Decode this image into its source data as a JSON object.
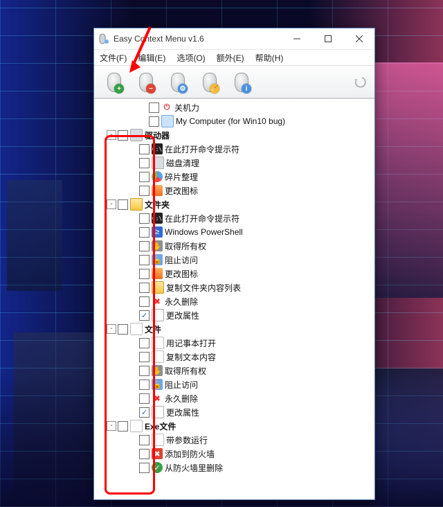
{
  "window": {
    "title": "Easy Context Menu v1.6"
  },
  "menu": {
    "file": "文件(F)",
    "edit": "编辑(E)",
    "options": "选项(O)",
    "extra": "额外(E)",
    "help": "帮助(H)"
  },
  "toolbar": {
    "btn_add": "apply-add",
    "btn_remove": "apply-remove",
    "btn_config": "settings",
    "btn_clean": "clean",
    "btn_info": "about",
    "btn_undo": "undo"
  },
  "tree": [
    {
      "indent": 60,
      "expander": null,
      "checked": false,
      "iconClass": "ic-power",
      "iconGlyph": "⏻",
      "label": "关机力",
      "bold": false
    },
    {
      "indent": 60,
      "expander": null,
      "checked": false,
      "iconClass": "ic-mon",
      "iconGlyph": "",
      "label": "My Computer (for Win10 bug)",
      "bold": false
    },
    {
      "indent": 14,
      "expander": "-",
      "checked": false,
      "iconClass": "ic-drv",
      "iconGlyph": "",
      "label": "驱动器",
      "bold": true
    },
    {
      "indent": 46,
      "expander": null,
      "checked": false,
      "iconClass": "ic-dark",
      "iconGlyph": "C:\\",
      "label": "在此打开命令提示符",
      "bold": false
    },
    {
      "indent": 46,
      "expander": null,
      "checked": false,
      "iconClass": "ic-drv",
      "iconGlyph": "",
      "label": "磁盘清理",
      "bold": false
    },
    {
      "indent": 46,
      "expander": null,
      "checked": false,
      "iconClass": "ic-pie",
      "iconGlyph": "",
      "label": "碎片整理",
      "bold": false
    },
    {
      "indent": 46,
      "expander": null,
      "checked": false,
      "iconClass": "ic-cfg",
      "iconGlyph": "",
      "label": "更改图标",
      "bold": false
    },
    {
      "indent": 14,
      "expander": "-",
      "checked": false,
      "iconClass": "ic-fold",
      "iconGlyph": "",
      "label": "文件夹",
      "bold": true
    },
    {
      "indent": 46,
      "expander": null,
      "checked": false,
      "iconClass": "ic-dark",
      "iconGlyph": "C:\\",
      "label": "在此打开命令提示符",
      "bold": false
    },
    {
      "indent": 46,
      "expander": null,
      "checked": false,
      "iconClass": "ic-blue",
      "iconGlyph": "≥",
      "label": "Windows PowerShell",
      "bold": false
    },
    {
      "indent": 46,
      "expander": null,
      "checked": false,
      "iconClass": "ic-gray",
      "iconGlyph": "✋",
      "label": "取得所有权",
      "bold": false
    },
    {
      "indent": 46,
      "expander": null,
      "checked": false,
      "iconClass": "ic-lock",
      "iconGlyph": "🔒",
      "label": "阻止访问",
      "bold": false
    },
    {
      "indent": 46,
      "expander": null,
      "checked": false,
      "iconClass": "ic-cfg",
      "iconGlyph": "",
      "label": "更改图标",
      "bold": false
    },
    {
      "indent": 46,
      "expander": null,
      "checked": false,
      "iconClass": "ic-fold",
      "iconGlyph": "",
      "label": "复制文件夹内容列表",
      "bold": false
    },
    {
      "indent": 46,
      "expander": null,
      "checked": false,
      "iconClass": "ic-redX",
      "iconGlyph": "✖",
      "label": "永久删除",
      "bold": false
    },
    {
      "indent": 46,
      "expander": null,
      "checked": true,
      "iconClass": "ic-prop",
      "iconGlyph": "",
      "label": "更改属性",
      "bold": false
    },
    {
      "indent": 14,
      "expander": "-",
      "checked": false,
      "iconClass": "ic-doc",
      "iconGlyph": "",
      "label": "文件",
      "bold": true
    },
    {
      "indent": 46,
      "expander": null,
      "checked": false,
      "iconClass": "ic-doc",
      "iconGlyph": "",
      "label": "用记事本打开",
      "bold": false
    },
    {
      "indent": 46,
      "expander": null,
      "checked": false,
      "iconClass": "ic-doc",
      "iconGlyph": "",
      "label": "复制文本内容",
      "bold": false
    },
    {
      "indent": 46,
      "expander": null,
      "checked": false,
      "iconClass": "ic-gray",
      "iconGlyph": "✋",
      "label": "取得所有权",
      "bold": false
    },
    {
      "indent": 46,
      "expander": null,
      "checked": false,
      "iconClass": "ic-lock",
      "iconGlyph": "🔒",
      "label": "阻止访问",
      "bold": false
    },
    {
      "indent": 46,
      "expander": null,
      "checked": false,
      "iconClass": "ic-redX",
      "iconGlyph": "✖",
      "label": "永久删除",
      "bold": false
    },
    {
      "indent": 46,
      "expander": null,
      "checked": true,
      "iconClass": "ic-prop",
      "iconGlyph": "",
      "label": "更改属性",
      "bold": false
    },
    {
      "indent": 14,
      "expander": "-",
      "checked": false,
      "iconClass": "ic-doc",
      "iconGlyph": "",
      "label": "Exe文件",
      "bold": true
    },
    {
      "indent": 46,
      "expander": null,
      "checked": false,
      "iconClass": "ic-doc",
      "iconGlyph": "",
      "label": "带参数运行",
      "bold": false
    },
    {
      "indent": 46,
      "expander": null,
      "checked": false,
      "iconClass": "ic-shield-red",
      "iconGlyph": "✖",
      "label": "添加到防火墙",
      "bold": false
    },
    {
      "indent": 46,
      "expander": null,
      "checked": false,
      "iconClass": "ic-grn",
      "iconGlyph": "✓",
      "label": "从防火墙里删除",
      "bold": false
    }
  ]
}
